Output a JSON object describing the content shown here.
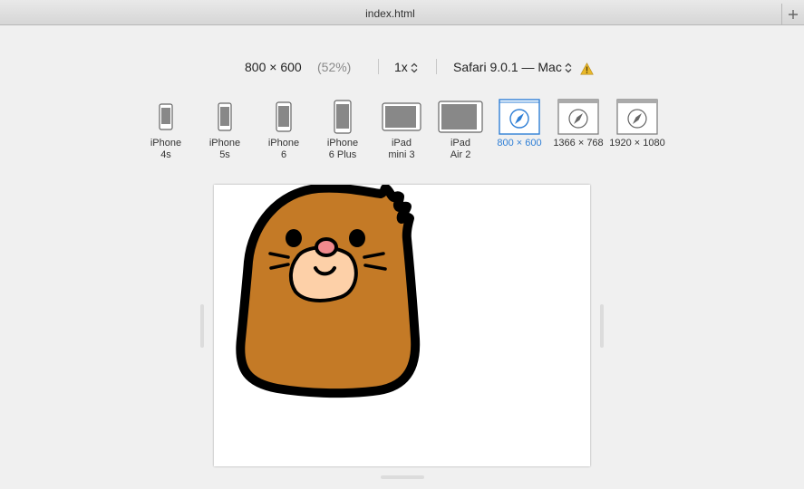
{
  "window": {
    "title": "index.html"
  },
  "toolbar": {
    "resolution": "800 × 600",
    "zoom_percent": "(52%)",
    "pixel_ratio": "1x",
    "user_agent": "Safari 9.0.1 — Mac"
  },
  "devices": [
    {
      "name": "iPhone 4s",
      "line1": "iPhone",
      "line2": "4s",
      "icon": "phone-icon"
    },
    {
      "name": "iPhone 5s",
      "line1": "iPhone",
      "line2": "5s",
      "icon": "phone-icon"
    },
    {
      "name": "iPhone 6",
      "line1": "iPhone",
      "line2": "6",
      "icon": "phone-icon"
    },
    {
      "name": "iPhone 6 Plus",
      "line1": "iPhone",
      "line2": "6 Plus",
      "icon": "phone-icon"
    },
    {
      "name": "iPad mini 3",
      "line1": "iPad",
      "line2": "mini 3",
      "icon": "tablet-icon"
    },
    {
      "name": "iPad Air 2",
      "line1": "iPad",
      "line2": "Air 2",
      "icon": "tablet-icon"
    },
    {
      "name": "800 × 600",
      "line1": "800 × 600",
      "line2": "",
      "icon": "browser-window-icon",
      "selected": true
    },
    {
      "name": "1366 × 768",
      "line1": "1366 × 768",
      "line2": "",
      "icon": "browser-window-icon"
    },
    {
      "name": "1920 × 1080",
      "line1": "1920 × 1080",
      "line2": "",
      "icon": "browser-window-icon"
    }
  ],
  "colors": {
    "accent": "#2f7fd6",
    "mole_body": "#c47a26",
    "mole_face": "#fdd0a8",
    "mole_nose": "#f08a8e",
    "warning": "#e8b82a"
  }
}
